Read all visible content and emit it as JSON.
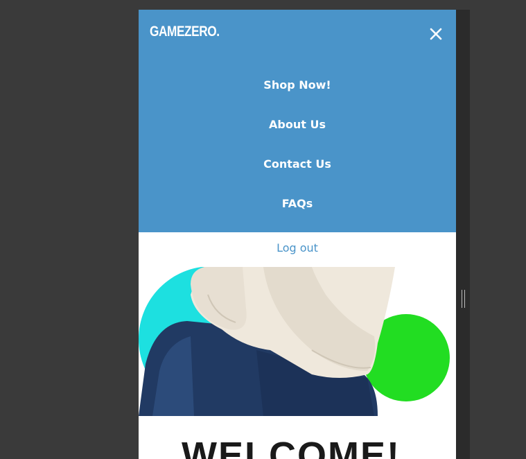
{
  "header": {
    "logo": "GAMEZERO.",
    "close_icon": "close-icon"
  },
  "nav": {
    "items": [
      {
        "label": "Shop Now!"
      },
      {
        "label": "About Us"
      },
      {
        "label": "Contact Us"
      },
      {
        "label": "FAQs"
      }
    ],
    "logout_label": "Log out"
  },
  "hero": {
    "heading": "WELCOME!"
  },
  "colors": {
    "menu_bg": "#4a94c9",
    "accent_cyan": "#1de0e0",
    "accent_green": "#22dd22",
    "page_bg": "#3a3a3a"
  }
}
